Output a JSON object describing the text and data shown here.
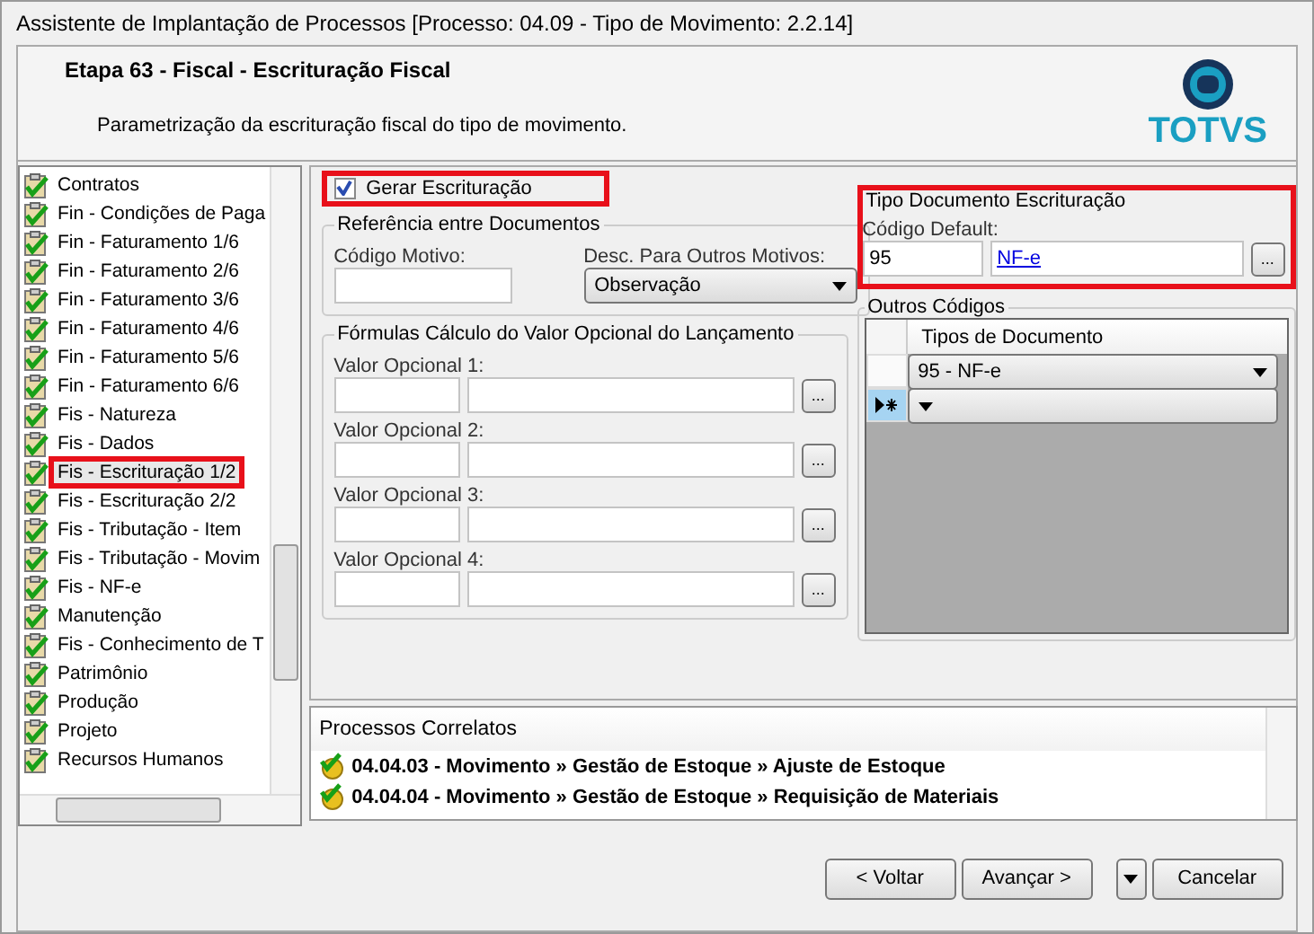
{
  "window": {
    "title": "Assistente de Implantação de Processos [Processo: 04.09 - Tipo de Movimento: 2.2.14]"
  },
  "header": {
    "step": "Etapa 63 - Fiscal - Escrituração Fiscal",
    "description": "Parametrização da escrituração fiscal do tipo de movimento.",
    "logo": "TOTVS"
  },
  "steps": [
    {
      "label": "Contratos",
      "selected": false,
      "highlighted": false
    },
    {
      "label": "Fin - Condições de Paga",
      "selected": false,
      "highlighted": false
    },
    {
      "label": "Fin - Faturamento 1/6",
      "selected": false,
      "highlighted": false
    },
    {
      "label": "Fin - Faturamento 2/6",
      "selected": false,
      "highlighted": false
    },
    {
      "label": "Fin - Faturamento 3/6",
      "selected": false,
      "highlighted": false
    },
    {
      "label": "Fin - Faturamento 4/6",
      "selected": false,
      "highlighted": false
    },
    {
      "label": "Fin - Faturamento 5/6",
      "selected": false,
      "highlighted": false
    },
    {
      "label": "Fin - Faturamento 6/6",
      "selected": false,
      "highlighted": false
    },
    {
      "label": "Fis - Natureza",
      "selected": false,
      "highlighted": false
    },
    {
      "label": "Fis - Dados",
      "selected": false,
      "highlighted": false
    },
    {
      "label": "Fis - Escrituração 1/2",
      "selected": true,
      "highlighted": true
    },
    {
      "label": "Fis - Escrituração 2/2",
      "selected": false,
      "highlighted": false
    },
    {
      "label": "Fis - Tributação - Item",
      "selected": false,
      "highlighted": false
    },
    {
      "label": "Fis - Tributação - Movim",
      "selected": false,
      "highlighted": false
    },
    {
      "label": "Fis - NF-e",
      "selected": false,
      "highlighted": false
    },
    {
      "label": "Manutenção",
      "selected": false,
      "highlighted": false
    },
    {
      "label": "Fis - Conhecimento de T",
      "selected": false,
      "highlighted": false
    },
    {
      "label": "Patrimônio",
      "selected": false,
      "highlighted": false
    },
    {
      "label": "Produção",
      "selected": false,
      "highlighted": false
    },
    {
      "label": "Projeto",
      "selected": false,
      "highlighted": false
    },
    {
      "label": "Recursos Humanos",
      "selected": false,
      "highlighted": false
    }
  ],
  "generate": {
    "label": "Gerar Escrituração",
    "checked": true,
    "highlighted": true
  },
  "reference": {
    "title": "Referência entre Documentos",
    "code_label": "Código Motivo:",
    "desc_label": "Desc. Para Outros Motivos:",
    "desc_value": "Observação"
  },
  "formulas": {
    "title": "Fórmulas Cálculo do Valor Opcional do Lançamento",
    "fields": [
      {
        "label": "Valor Opcional 1:",
        "button": "..."
      },
      {
        "label": "Valor Opcional 2:",
        "button": "..."
      },
      {
        "label": "Valor Opcional 3:",
        "button": "..."
      },
      {
        "label": "Valor Opcional 4:",
        "button": "..."
      }
    ]
  },
  "document_type": {
    "title": "Tipo Documento Escrituração",
    "default_label": "Código Default:",
    "code": "95",
    "name": "NF-e",
    "button": "...",
    "highlighted": true
  },
  "other_codes": {
    "title": "Outros Códigos",
    "column": "Tipos de Documento",
    "rows": [
      {
        "value": "95 - NF-e",
        "new": false
      },
      {
        "new": true
      }
    ]
  },
  "related": {
    "title": "Processos Correlatos",
    "items": [
      {
        "text": "04.04.03 - Movimento » Gestão de Estoque » Ajuste de Estoque"
      },
      {
        "text": "04.04.04 - Movimento » Gestão de Estoque » Requisição de Materiais"
      }
    ]
  },
  "buttons": [
    {
      "kind": "button",
      "label": "< Voltar"
    },
    {
      "kind": "button",
      "label": "Avançar >"
    },
    {
      "kind": "menu"
    },
    {
      "kind": "button",
      "label": "Cancelar"
    }
  ]
}
